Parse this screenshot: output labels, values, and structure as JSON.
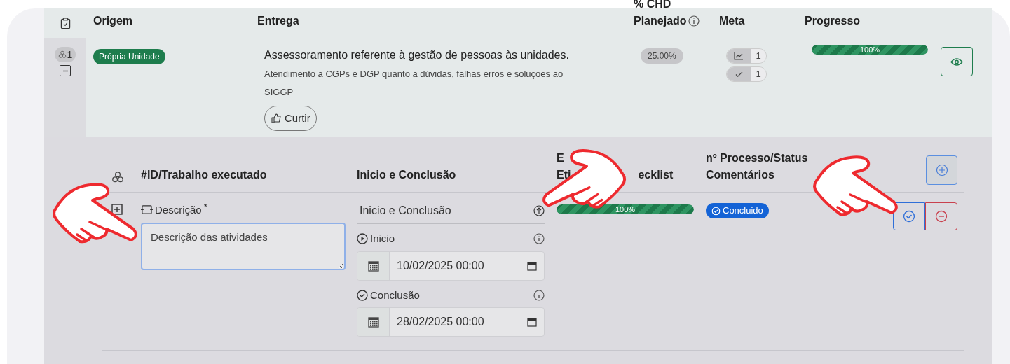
{
  "header": {
    "origem": "Origem",
    "entrega": "Entrega",
    "chd": "% CHD",
    "planejado": "Planejado",
    "meta": "Meta",
    "progresso": "Progresso"
  },
  "rows": [
    {
      "count": "1",
      "expanded": true,
      "origem": "Própria Unidade",
      "title": "Assessoramento referente à gestão de pessoas às unidades.",
      "description": "Atendimento a CGPs e DGP quanto a dúvidas, falhas erros e soluções ao SIGGP",
      "like_button": "Curtir",
      "planejado": "25.00%",
      "meta": [
        {
          "kind": "chart",
          "value": "1"
        },
        {
          "kind": "check",
          "value": "1"
        }
      ],
      "progress": {
        "level": 1,
        "label": "100%"
      },
      "subtable": {
        "id_col": "#ID/Trabalho executado",
        "dates_col": "Inicio e Conclusão",
        "tags_col_line1": "E",
        "tags_col_line2_start": "Eti",
        "tags_col_line2_end": "ecklist",
        "process_col_line1": "nº Processo/Status",
        "process_col_line2": "Comentários",
        "items": [
          {
            "description_label": "Descrição",
            "required_mark": "*",
            "description_value": "Descrição das atividades",
            "dates_title": "Inicio e Conclusão",
            "start_label": "Inicio",
            "start_value": "10/02/2025 00:00",
            "end_label": "Conclusão",
            "end_value": "28/02/2025 00:00",
            "progress": {
              "level": 1,
              "label": "100%"
            },
            "status": "Concluido"
          }
        ]
      }
    }
  ]
}
